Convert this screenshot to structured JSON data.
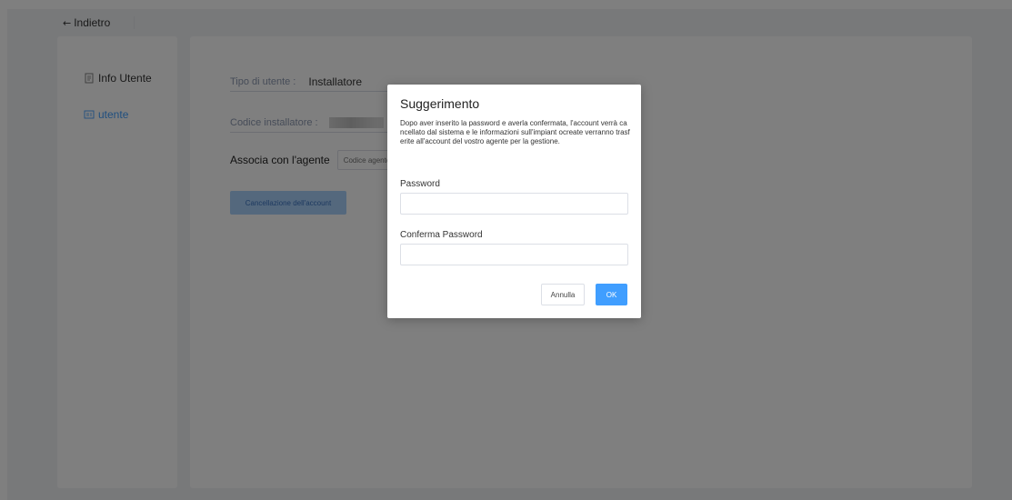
{
  "topbar": {
    "back_label": "Indietro"
  },
  "sidebar": {
    "items": [
      {
        "label": "Info Utente",
        "icon": "document-icon"
      },
      {
        "label": "utente",
        "icon": "id-card-icon"
      }
    ]
  },
  "main": {
    "user_type_label": "Tipo di utente :",
    "user_type_value": "Installatore",
    "installer_code_label": "Codice installatore :",
    "associate_label": "Associa con l'agente",
    "agent_code_placeholder": "Codice agente",
    "cancel_account_label": "Cancellazione dell'account"
  },
  "dialog": {
    "title": "Suggerimento",
    "message": "Dopo aver inserito la password e averla confermata, l'account verrà cancellato dal sistema e le informazioni sull'impiant ocreate verranno trasferite all'account del vostro agente per la gestione.",
    "password_label": "Password",
    "confirm_password_label": "Conferma Password",
    "cancel_label": "Annulla",
    "ok_label": "OK"
  },
  "colors": {
    "accent": "#409eff",
    "overlay": "rgba(0,0,0,0.5)",
    "label": "#8c98b0"
  }
}
